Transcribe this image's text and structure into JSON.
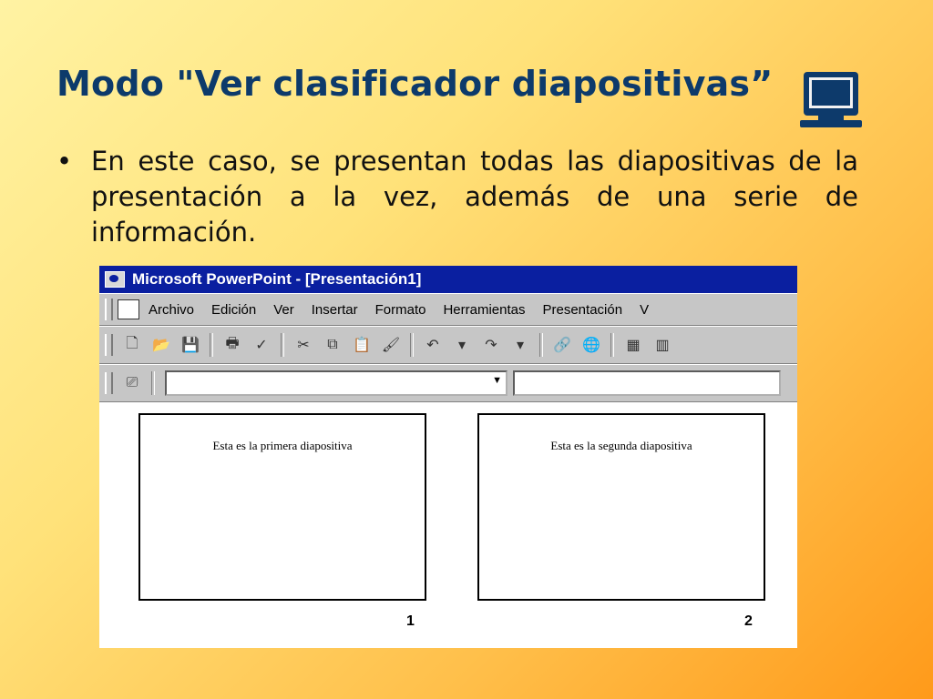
{
  "slide": {
    "title": "Modo \"Ver clasificador diapositivas”",
    "bullet_symbol": "•",
    "bullet_text": "En este caso, se presentan todas las diapositivas de la presentación a la vez, además de una serie de información."
  },
  "powerpoint": {
    "window_title": "Microsoft PowerPoint - [Presentación1]",
    "menu": [
      "Archivo",
      "Edición",
      "Ver",
      "Insertar",
      "Formato",
      "Herramientas",
      "Presentación",
      "V"
    ],
    "toolbar_icons": [
      "new-icon",
      "open-icon",
      "save-icon",
      "print-icon",
      "spellcheck-icon",
      "cut-icon",
      "copy-icon",
      "paste-icon",
      "format-painter-icon",
      "undo-icon",
      "redo-icon",
      "hyperlink-icon",
      "web-icon",
      "table-icon"
    ],
    "slides": [
      {
        "text": "Esta es la primera diapositiva",
        "number": "1"
      },
      {
        "text": "Esta es la segunda diapositiva",
        "number": "2"
      }
    ]
  },
  "colors": {
    "title": "#0d3a6b",
    "titlebar": "#0a1fa0",
    "chrome": "#c6c6c6"
  }
}
